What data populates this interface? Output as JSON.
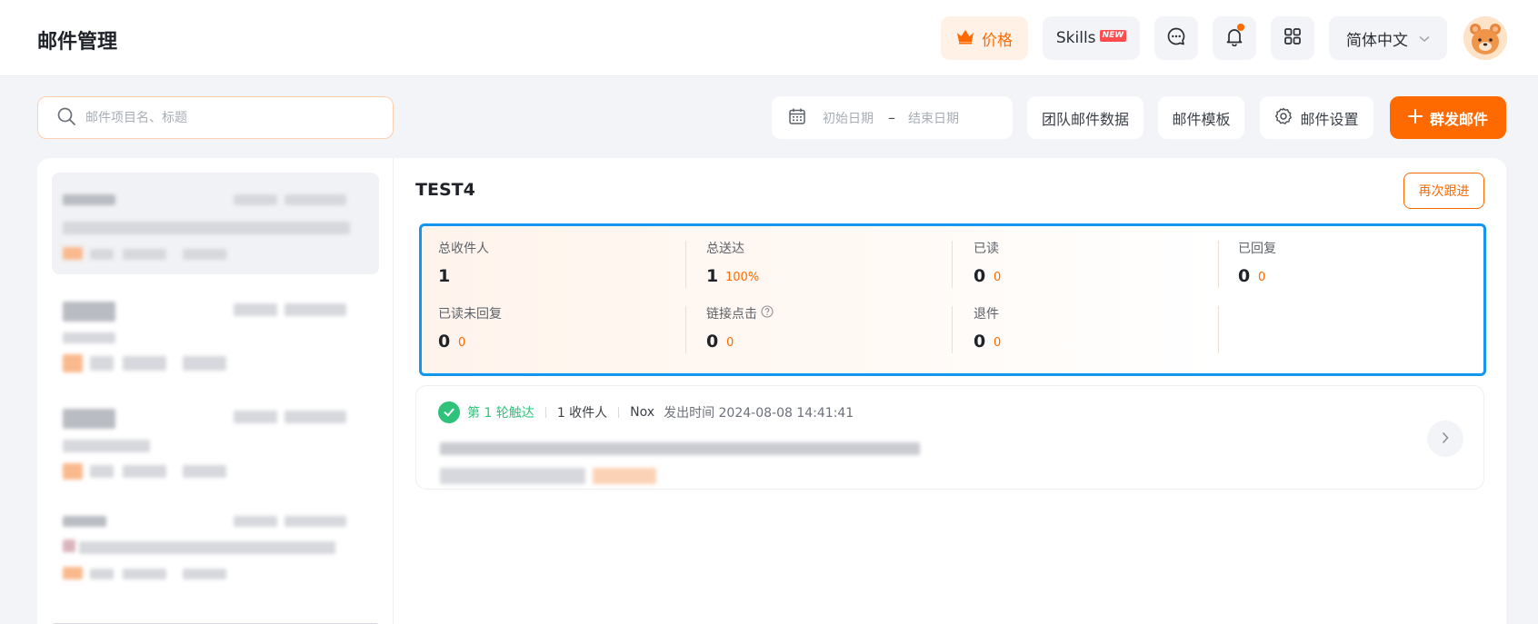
{
  "header": {
    "title": "邮件管理",
    "price_label": "价格",
    "skills_label": "Skills",
    "skills_badge": "NEW",
    "language": "简体中文",
    "icons": [
      "crown-icon",
      "chat-icon",
      "bell-icon",
      "apps-grid-icon",
      "chevron-down-icon",
      "avatar"
    ]
  },
  "toolbar": {
    "search_placeholder": "邮件项目名、标题",
    "date_start_placeholder": "初始日期",
    "date_separator": "–",
    "date_end_placeholder": "结束日期",
    "team_data_label": "团队邮件数据",
    "template_label": "邮件模板",
    "settings_label": "邮件设置",
    "mass_send_label": "群发邮件"
  },
  "detail": {
    "title": "TEST4",
    "follow_up_label": "再次跟进",
    "stats": {
      "total_recipients": {
        "label": "总收件人",
        "value": "1"
      },
      "total_delivered": {
        "label": "总送达",
        "value": "1",
        "sub": "100%"
      },
      "read": {
        "label": "已读",
        "value": "0",
        "sub": "0"
      },
      "replied": {
        "label": "已回复",
        "value": "0",
        "sub": "0"
      },
      "read_no_reply": {
        "label": "已读未回复",
        "value": "0",
        "sub": "0"
      },
      "link_clicks": {
        "label": "链接点击",
        "value": "0",
        "sub": "0"
      },
      "unsubscribed": {
        "label": "退件",
        "value": "0",
        "sub": "0"
      }
    },
    "round": {
      "label": "第 1 轮触达",
      "recipients": "1 收件人",
      "sender": "Nox",
      "send_time": "发出时间 2024-08-08 14:41:41"
    }
  },
  "colors": {
    "accent": "#ff6a00",
    "success": "#2fc27a",
    "highlight_border": "#1296f0"
  }
}
